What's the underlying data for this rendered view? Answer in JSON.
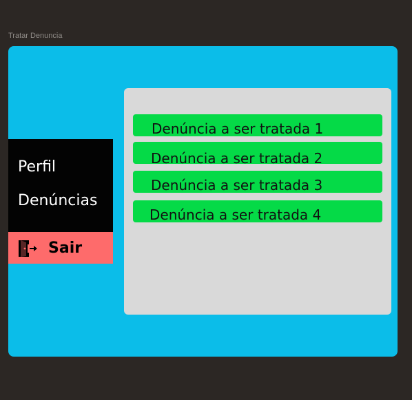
{
  "frame": {
    "label": "Tratar Denuncia"
  },
  "sidebar": {
    "items": [
      {
        "label": "Perfil"
      },
      {
        "label": "Denúncias"
      }
    ],
    "logout": {
      "label": "Sair",
      "icon": "door-exit-icon"
    }
  },
  "content": {
    "reports": [
      {
        "label": "Denúncia a ser tratada 1"
      },
      {
        "label": "Denúncia a ser tratada 2"
      },
      {
        "label": "Denúncia a ser tratada 3"
      },
      {
        "label": "Denúncia a ser tratada 4"
      }
    ]
  },
  "colors": {
    "background": "#2c2724",
    "app_frame": "#0bbde9",
    "sidebar": "#030303",
    "logout": "#fe6b6b",
    "content_panel": "#d9d9d9",
    "report_item": "#05da47"
  }
}
